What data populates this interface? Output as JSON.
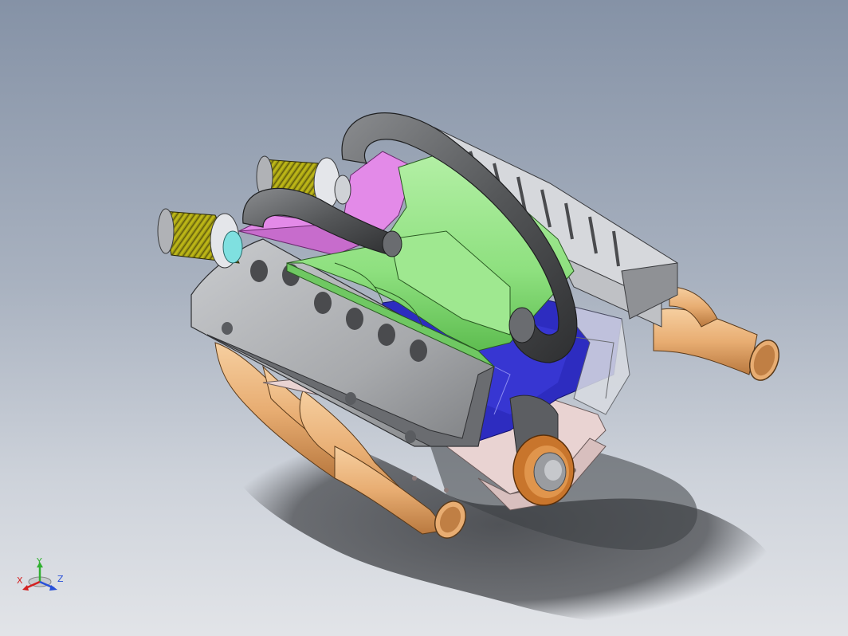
{
  "viewport": {
    "background_top": "#8592a6",
    "background_bottom": "#e2e4e8"
  },
  "model": {
    "parts": [
      "shadow",
      "exhaust-header-right",
      "exhaust-header-left",
      "oil-pan",
      "engine-block",
      "crankshaft-pulley",
      "valve-cover-right",
      "valve-cover-left",
      "air-filter-front",
      "air-filter-rear",
      "intake-manifold",
      "intake-runner-bracket",
      "intake-tube-upper",
      "intake-tube-lower"
    ],
    "colors": {
      "intake_manifold": "#8ee07f",
      "bracket": "#e38ae8",
      "engine_block": "#2d2cc0",
      "exhaust": "#e8ad72",
      "air_filter": "#c8c218",
      "intake_tube": "#555759",
      "valve_cover": "#a7a9ac",
      "oil_pan": "#e9d3d2",
      "pulley": "#c8752c"
    }
  },
  "triad": {
    "x_label": "X",
    "y_label": "Y",
    "z_label": "Z",
    "x_color": "#d42020",
    "y_color": "#30b030",
    "z_color": "#2850d8"
  }
}
